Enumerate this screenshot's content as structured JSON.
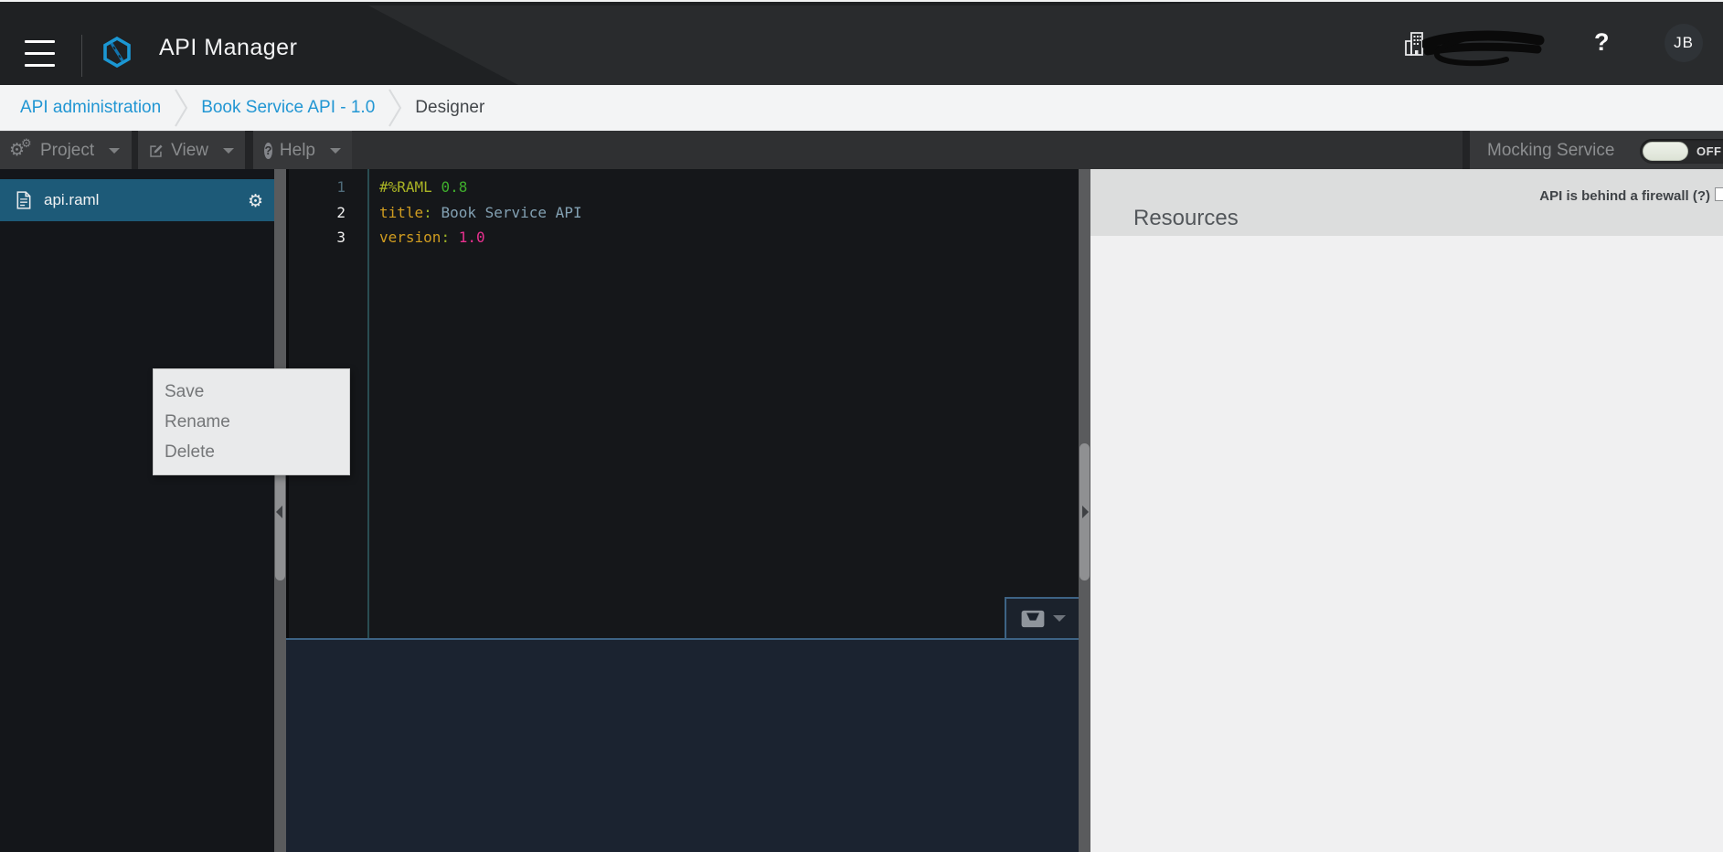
{
  "colors": {
    "header_bg": "#1f2123",
    "header_band": "#292b2d",
    "accent_blue": "#2196d3",
    "selected_file_bg": "#1d5a78",
    "console_border": "#3d6384",
    "toggle_knob": "#e6ebe1",
    "menu_bg": "#e9eaeb",
    "editor_bg": "#15171a",
    "resources_head_bg": "#dcdddd"
  },
  "header": {
    "title": "API Manager",
    "help_glyph": "?",
    "avatar_initials": "JB"
  },
  "breadcrumb": {
    "items": [
      {
        "label": "API administration"
      },
      {
        "label": "Book Service API - 1.0"
      },
      {
        "label": "Designer"
      }
    ]
  },
  "toolbar": {
    "menus": [
      {
        "label": "Project",
        "icon": "gears-icon"
      },
      {
        "label": "View",
        "icon": "edit-icon"
      },
      {
        "label": "Help",
        "icon": "help-circle-icon"
      }
    ],
    "mocking": {
      "label": "Mocking Service",
      "state": "OFF"
    }
  },
  "sidebar": {
    "files": [
      {
        "name": "api.raml",
        "selected": true
      }
    ]
  },
  "context_menu": {
    "items": [
      {
        "label": "Save"
      },
      {
        "label": "Rename"
      },
      {
        "label": "Delete"
      }
    ]
  },
  "editor": {
    "lines": [
      {
        "number": "1",
        "gutter_color": "#4f6b7a",
        "tokens": [
          {
            "text": "#%RAML",
            "color": "#a9b325"
          },
          {
            "text": " ",
            "color": "#c8c8c8"
          },
          {
            "text": "0.8",
            "color": "#3fae2c"
          }
        ]
      },
      {
        "number": "2",
        "gutter_color": "#efefef",
        "tokens": [
          {
            "text": "title",
            "color": "#d09c20"
          },
          {
            "text": ":",
            "color": "#9bb027"
          },
          {
            "text": " ",
            "color": "#c8c8c8"
          },
          {
            "text": "Book Service API",
            "color": "#83a1b3"
          }
        ]
      },
      {
        "number": "3",
        "gutter_color": "#efefef",
        "tokens": [
          {
            "text": "version",
            "color": "#d09c20"
          },
          {
            "text": ":",
            "color": "#9bb027"
          },
          {
            "text": " ",
            "color": "#c8c8c8"
          },
          {
            "text": "1.0",
            "color": "#e8308f"
          }
        ]
      }
    ]
  },
  "resources_panel": {
    "title": "Resources",
    "firewall_label": "API is behind a firewall (?)"
  }
}
